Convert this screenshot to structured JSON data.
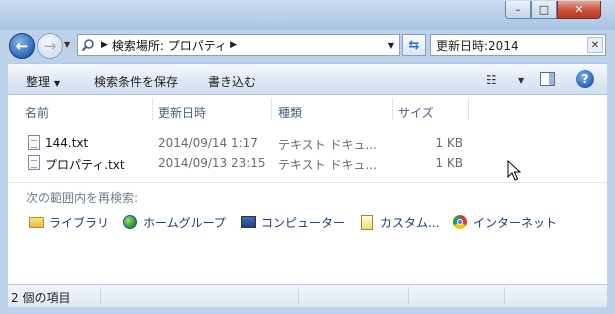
{
  "window": {
    "title": "検索場所: プロパティ",
    "caption_buttons": {
      "minimize": "–",
      "maximize": "□",
      "close": "✕"
    }
  },
  "nav": {
    "back_glyph": "←",
    "forward_glyph": "→",
    "address": "検索場所: プロパティ",
    "address_sep": "▶",
    "search_value": "更新日時:2014",
    "search_clear": "✕"
  },
  "toolbar": {
    "organize": "整理",
    "save_search": "検索条件を保存",
    "burn": "書き込む",
    "help": "?"
  },
  "columns": [
    "名前",
    "更新日時",
    "種類",
    "サイズ"
  ],
  "files": [
    {
      "name": "144.txt",
      "modified": "2014/09/14 1:17",
      "type": "テキスト ドキュ...",
      "size": "1 KB"
    },
    {
      "name": "プロパティ.txt",
      "modified": "2014/09/13 23:15",
      "type": "テキスト ドキュ...",
      "size": "1 KB"
    }
  ],
  "search_again": {
    "label": "次の範囲内を再検索:",
    "locations": [
      {
        "label": "ライブラリ",
        "icon": "library-icon"
      },
      {
        "label": "ホームグループ",
        "icon": "homegroup-icon"
      },
      {
        "label": "コンピューター",
        "icon": "computer-icon"
      },
      {
        "label": "カスタム...",
        "icon": "custom-icon"
      },
      {
        "label": "インターネット",
        "icon": "internet-icon"
      }
    ]
  },
  "status": {
    "item_count": "2 個の項目"
  }
}
